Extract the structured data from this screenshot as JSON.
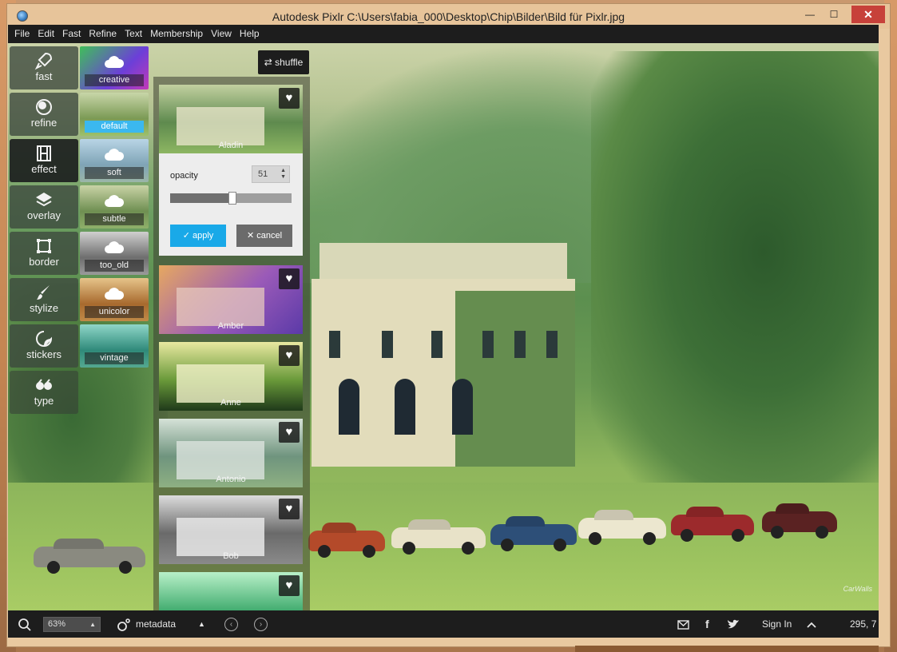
{
  "window": {
    "title": "Autodesk Pixlr   C:\\Users\\fabia_000\\Desktop\\Chip\\Bilder\\Bild für Pixlr.jpg",
    "controls": {
      "minimize": "—",
      "maximize": "☐",
      "close": "✕"
    }
  },
  "menu": [
    "File",
    "Edit",
    "Fast",
    "Refine",
    "Text",
    "Membership",
    "View",
    "Help"
  ],
  "tools": [
    {
      "label": "fast",
      "icon": "rocket-icon"
    },
    {
      "label": "refine",
      "icon": "refine-icon"
    },
    {
      "label": "effect",
      "icon": "film-icon",
      "active": true
    },
    {
      "label": "overlay",
      "icon": "layers-icon"
    },
    {
      "label": "border",
      "icon": "border-icon"
    },
    {
      "label": "stylize",
      "icon": "brush-icon"
    },
    {
      "label": "stickers",
      "icon": "sticker-icon"
    },
    {
      "label": "type",
      "icon": "quote-icon"
    }
  ],
  "categories": [
    {
      "label": "creative",
      "selected": false
    },
    {
      "label": "default",
      "selected": true
    },
    {
      "label": "soft",
      "selected": false
    },
    {
      "label": "subtle",
      "selected": false
    },
    {
      "label": "too_old",
      "selected": false
    },
    {
      "label": "unicolor",
      "selected": false
    },
    {
      "label": "vintage",
      "selected": false
    }
  ],
  "shuffle_label": "shuffle",
  "effects": [
    {
      "name": "Aladin"
    },
    {
      "name": "Amber"
    },
    {
      "name": "Anne"
    },
    {
      "name": "Antonio"
    },
    {
      "name": "Bob"
    },
    {
      "name": ""
    }
  ],
  "opacity_panel": {
    "label": "opacity",
    "value": "51",
    "slider_fraction": 0.51,
    "apply_label": "apply",
    "cancel_label": "cancel"
  },
  "canvas": {
    "watermark": "CarWalls"
  },
  "statusbar": {
    "zoom": "63%",
    "metadata_label": "metadata",
    "sign_in": "Sign In",
    "coords": "295, 7"
  },
  "colors": {
    "accent": "#19a9e8",
    "panel_dark": "#1d1d1d",
    "close_red": "#c7413a"
  }
}
